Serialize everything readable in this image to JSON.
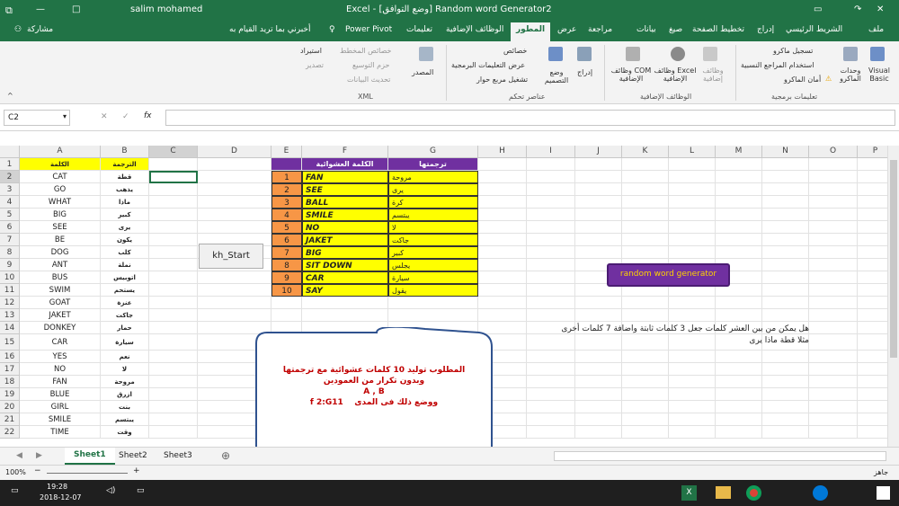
{
  "titlebar": {
    "title": "Excel - [وضع التوافق] Random word Generator2",
    "user": "salim mohamed"
  },
  "tabs": [
    "ملف",
    "الشريط الرئيسي",
    "إدراج",
    "تخطيط الصفحة",
    "صيغ",
    "بيانات",
    "مراجعة",
    "عرض",
    "المطور",
    "الوظائف الإضافية",
    "تعليمات",
    "Power Pivot"
  ],
  "tell_me": "أخبرني بما تريد القيام به",
  "share": "مشاركة",
  "ribbon": {
    "visual_basic": "Visual Basic",
    "macros": "وحدات الماكرو",
    "record_macro": "تسجيل ماكرو",
    "relative_refs": "استخدام المراجع النسبية",
    "macro_security": "أمان الماكرو",
    "group_code": "تعليمات برمجية",
    "addins": "وظائف إضافية",
    "excel_addins": "وظائف Excel الإضافية",
    "com_addins": "وظائف COM الإضافية",
    "group_addins": "الوظائف الإضافية",
    "insert": "إدراج",
    "design_mode": "وضع التصميم",
    "properties": "خصائص",
    "view_code": "عرض التعليمات البرمجية",
    "run_dialog": "تشغيل مربع حوار",
    "group_controls": "عناصر تحكم",
    "source": "المصدر",
    "map_props": "خصائص المخطط",
    "expansion_packs": "حزم التوسيع",
    "refresh_data": "تحديث البيانات",
    "import": "استيراد",
    "export": "تصدير",
    "group_xml": "XML"
  },
  "namebox": "C2",
  "fx": "fx",
  "columns": [
    "A",
    "B",
    "C",
    "D",
    "E",
    "F",
    "G",
    "H",
    "I",
    "J",
    "K",
    "L",
    "M",
    "N",
    "O",
    "P"
  ],
  "rows": [
    "1",
    "2",
    "3",
    "4",
    "5",
    "6",
    "7",
    "8",
    "9",
    "10",
    "11",
    "12",
    "13",
    "14",
    "15",
    "16",
    "17",
    "18",
    "19",
    "20",
    "21",
    "22"
  ],
  "colA_header": "الكلمة",
  "colB_header": "الترجمة",
  "words": [
    "CAT",
    "GO",
    "WHAT",
    "BIG",
    "SEE",
    "BE",
    "DOG",
    "ANT",
    "BUS",
    "SWIM",
    "GOAT",
    "JAKET",
    "DONKEY",
    "CAR",
    "YES",
    "NO",
    "FAN",
    "BLUE",
    "GIRL",
    "SMILE",
    "TIME"
  ],
  "trans": [
    "قطة",
    "يذهب",
    "ماذا",
    "كبير",
    "يرى",
    "يكون",
    "كلب",
    "نملة",
    "اتوبيس",
    "يستحم",
    "عنزة",
    "جاكت",
    "حمار",
    "سيارة",
    "نعم",
    "لا",
    "مروحة",
    "ازرق",
    "بنت",
    "يبتسم",
    "وقت"
  ],
  "table_header_f": "الكلمة العشوائية",
  "table_header_g": "ترجمتها",
  "nums": [
    "1",
    "2",
    "3",
    "4",
    "5",
    "6",
    "7",
    "8",
    "9",
    "10"
  ],
  "rand_words": [
    "FAN",
    "SEE",
    "BALL",
    "SMILE",
    "NO",
    "JAKET",
    "BIG",
    "SIT DOWN",
    "CAR",
    "SAY"
  ],
  "rand_trans": [
    "مروحة",
    "يرى",
    "كرة",
    "يبتسم",
    "لا",
    "جاكت",
    "كبير",
    "يجلس",
    "سيارة",
    "يقول"
  ],
  "button": "kh_Start",
  "generator_label": "random   word  generator",
  "question_line1": "هل يمكن من بين العشر كلمات جعل 3 كلمات ثابتة  واضافة 7 كلمات أخرى",
  "question_line2": "مثلا  قطة  ماذا  يرى",
  "note1": "المطلوب توليد 10 كلمات عشوائية مع ترجمتها",
  "note2": "وبدون تكرار من العمودين",
  "note3": "A , B",
  "note4": "ووضع ذلك فى المدى",
  "note5": "f 2:G11",
  "sheets": [
    "Sheet1",
    "Sheet2",
    "Sheet3"
  ],
  "status_ready": "جاهز",
  "zoom": "100%",
  "time": "19:28",
  "date": "2018-12-07",
  "colors": {
    "excel_green": "#217346",
    "header_yellow": "#ffff00",
    "table_purple": "#7030a0",
    "orange": "#f79646",
    "red_text": "#c00000"
  }
}
